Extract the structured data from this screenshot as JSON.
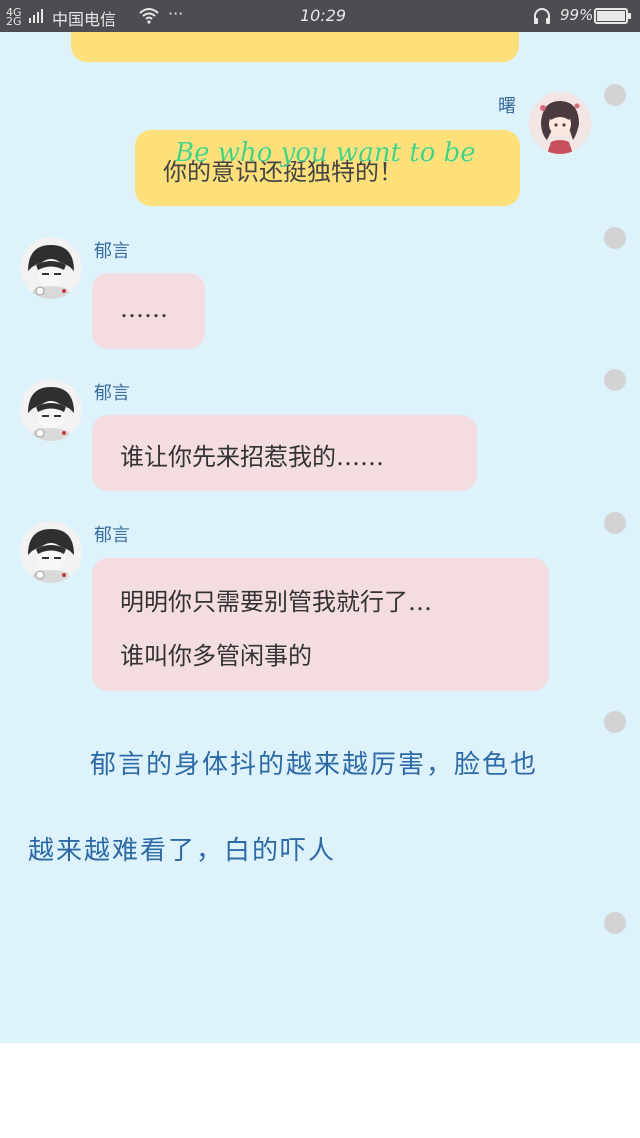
{
  "status_bar": {
    "network": "4G 2G",
    "carrier": "中国电信",
    "more": "···",
    "time": "10:29",
    "battery": "99%"
  },
  "messages": [
    {
      "sender": "曙",
      "overlay": "Be who you want to be",
      "text": "你的意识还挺独特的！"
    },
    {
      "sender": "郁言",
      "lines": [
        "……"
      ]
    },
    {
      "sender": "郁言",
      "lines": [
        "谁让你先来招惹我的……"
      ]
    },
    {
      "sender": "郁言",
      "lines": [
        "明明你只需要别管我就行了…",
        "谁叫你多管闲事的"
      ]
    }
  ],
  "narration": {
    "line1": "郁言的身体抖的越来越厉害，脸色也",
    "line2": "越来越难看了，白的吓人"
  },
  "colors": {
    "status_bg": "#4b4d50",
    "chat_bg": "#ddf2fb",
    "bubble_yellow": "#fde07a",
    "bubble_pink": "#f3dde0",
    "name_blue": "#3b6fa0",
    "narration_blue": "#2d6aa6",
    "overlay_green": "#3fd07a"
  }
}
